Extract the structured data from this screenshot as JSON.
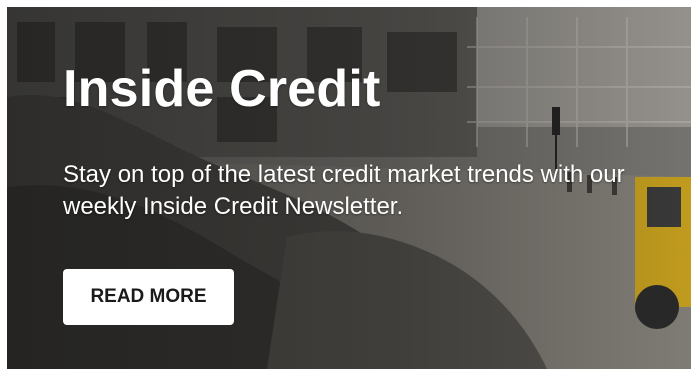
{
  "banner": {
    "title": "Inside Credit",
    "description": "Stay on top of the latest credit market trends with our weekly Inside Credit Newsletter.",
    "cta_label": "READ MORE",
    "background_image": "construction-site-photo"
  },
  "colors": {
    "title_text": "#ffffff",
    "button_background": "#ffffff",
    "button_text": "#1a1a1a"
  }
}
